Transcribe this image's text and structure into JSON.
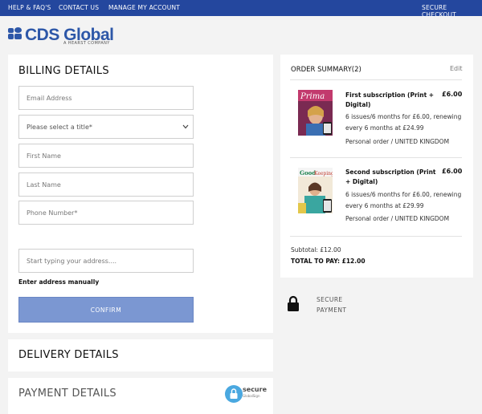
{
  "nav": {
    "help": "HELP & FAQ'S",
    "contact": "CONTACT US",
    "account": "MANAGE MY ACCOUNT",
    "secure_checkout": "SECURE CHECKOUT"
  },
  "brand": {
    "name": "CDS Global",
    "tagline": "A HEARST COMPANY",
    "color": "#2d57a8"
  },
  "billing": {
    "title": "BILLING DETAILS",
    "email_placeholder": "Email Address",
    "title_select": "Please select a title*",
    "first_name_placeholder": "First Name",
    "last_name_placeholder": "Last Name",
    "phone_placeholder": "Phone Number*",
    "address_placeholder": "Start typing your address....",
    "manual_link": "Enter address manually",
    "confirm_label": "CONFIRM"
  },
  "delivery": {
    "title": "DELIVERY DETAILS"
  },
  "payment": {
    "title": "PAYMENT DETAILS",
    "badge_word": "secure",
    "badge_small": "GlobalSign"
  },
  "summary": {
    "title": "ORDER SUMMARY(2)",
    "edit": "Edit",
    "items": [
      {
        "title": "First subscription (Print + Digital)",
        "price": "£6.00",
        "desc": "6 issues/6 months for £6.00, renewing every 6 months at £24.99",
        "order": "Personal order / UNITED KINGDOM"
      },
      {
        "title": "Second subscription (Print + Digital)",
        "price": "£6.00",
        "desc": "6 issues/6 months for £6.00, renewing every 6 months at £29.99",
        "order": "Personal order / UNITED KINGDOM"
      }
    ],
    "subtotal": "Subtotal: £12.00",
    "total": "TOTAL TO PAY: £12.00"
  },
  "secure": {
    "label": "SECURE PAYMENT"
  },
  "colors": {
    "nav_bg": "#24479e",
    "confirm_bg": "#7b97d2",
    "page_bg": "#f3f3f3"
  }
}
